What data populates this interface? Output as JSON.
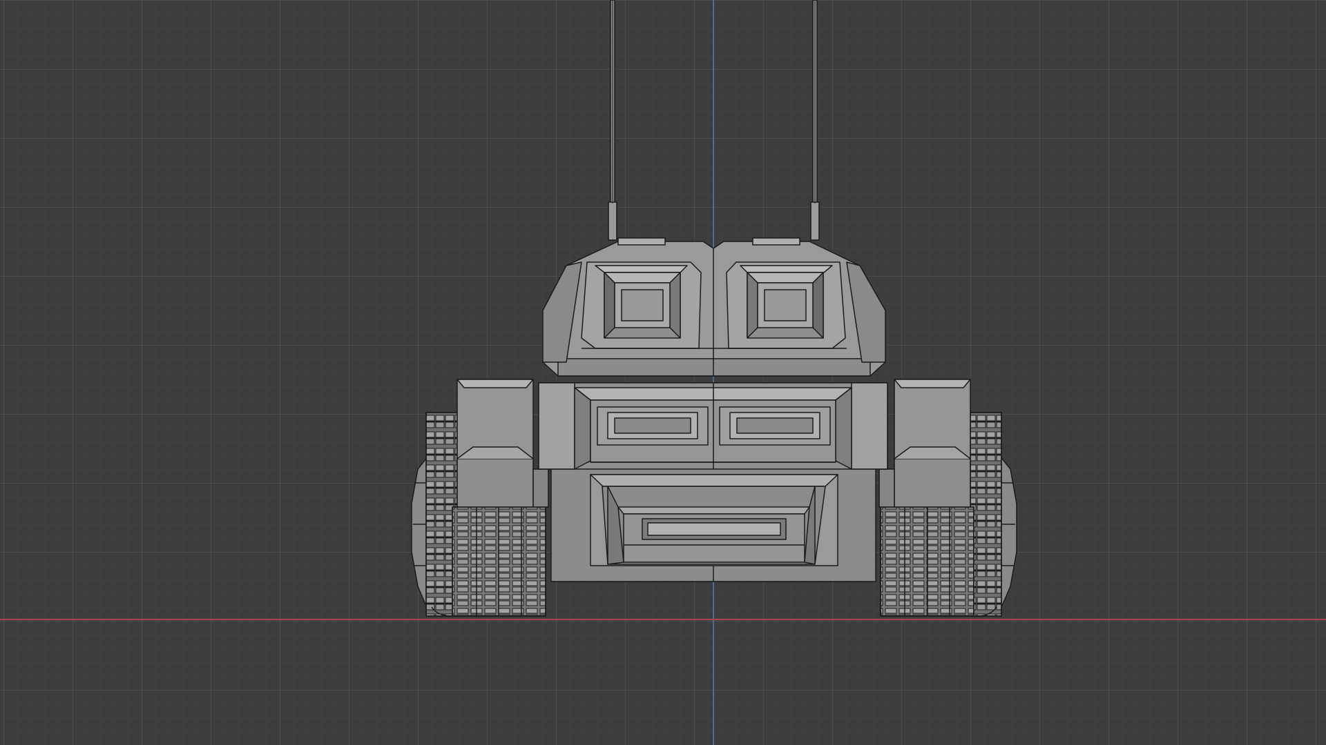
{
  "app": {
    "view": "3d-viewport",
    "projection": "orthographic",
    "view_direction": "front"
  },
  "viewport": {
    "background_color": "#3d3d3d",
    "grid_minor_color": "#474747",
    "grid_major_color": "#525252",
    "axis_x_color": "#a8454f",
    "axis_z_color": "#4a6e9c",
    "grid_visible": true
  },
  "model": {
    "object": "tank",
    "shading": "solid",
    "wireframe_overlay": true,
    "base_color": "#8f8f8f",
    "edge_color": "#1a1a1a"
  }
}
